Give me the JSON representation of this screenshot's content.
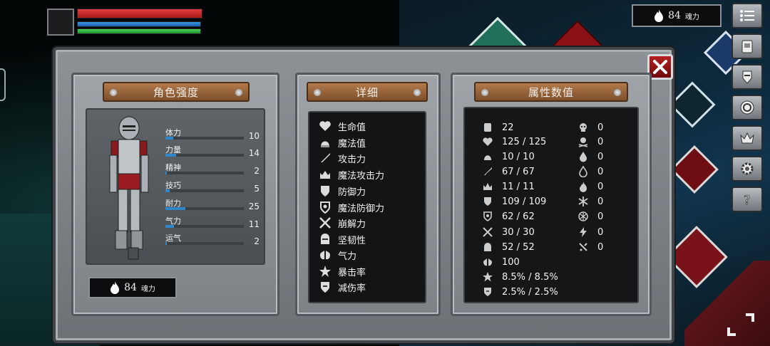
{
  "hud": {
    "soul_count": "84",
    "soul_unit": "魂力",
    "bars": {
      "health": 1.0,
      "mana": 1.0,
      "stamina": 1.0
    }
  },
  "panels": {
    "character": {
      "title": "角色强度",
      "stats": [
        {
          "label": "体力",
          "value": "10",
          "level": 0.1
        },
        {
          "label": "力量",
          "value": "14",
          "level": 0.14
        },
        {
          "label": "精神",
          "value": "2",
          "level": 0.02
        },
        {
          "label": "技巧",
          "value": "5",
          "level": 0.05
        },
        {
          "label": "耐力",
          "value": "25",
          "level": 0.25
        },
        {
          "label": "气力",
          "value": "11",
          "level": 0.11
        },
        {
          "label": "运气",
          "value": "2",
          "level": 0.02
        }
      ],
      "soul_count": "84",
      "soul_unit": "魂力"
    },
    "details": {
      "title": "详细",
      "items": [
        {
          "label": "生命值",
          "icon": "heart-icon"
        },
        {
          "label": "魔法值",
          "icon": "mana-icon"
        },
        {
          "label": "攻击力",
          "icon": "sword-icon"
        },
        {
          "label": "魔法攻击力",
          "icon": "magic-attack-icon"
        },
        {
          "label": "防御力",
          "icon": "shield-icon"
        },
        {
          "label": "魔法防御力",
          "icon": "magic-defense-icon"
        },
        {
          "label": "崩解力",
          "icon": "crossed-swords-icon"
        },
        {
          "label": "坚韧性",
          "icon": "helmet-icon"
        },
        {
          "label": "气力",
          "icon": "lungs-icon"
        },
        {
          "label": "暴击率",
          "icon": "critical-star-icon"
        },
        {
          "label": "减伤率",
          "icon": "damage-reduction-icon"
        }
      ]
    },
    "attributes": {
      "title": "属性数值",
      "left_values": [
        {
          "icon": "weight-icon",
          "value": "22"
        },
        {
          "icon": "heart-icon",
          "value": "125 / 125"
        },
        {
          "icon": "mana-icon",
          "value": "10 / 10"
        },
        {
          "icon": "sword-icon",
          "value": "67 / 67"
        },
        {
          "icon": "magic-attack-icon",
          "value": "11 / 11"
        },
        {
          "icon": "shield-icon",
          "value": "109 / 109"
        },
        {
          "icon": "magic-defense-icon",
          "value": "62 / 62"
        },
        {
          "icon": "crossed-swords-icon",
          "value": "30 / 30"
        },
        {
          "icon": "helmet-icon",
          "value": "52 / 52"
        },
        {
          "icon": "lungs-icon",
          "value": "100"
        },
        {
          "icon": "critical-star-icon",
          "value": "8.5% / 8.5%"
        },
        {
          "icon": "damage-reduction-icon",
          "value": "2.5% / 2.5%"
        }
      ],
      "right_values": [
        {
          "icon": "skull-icon",
          "value": "0"
        },
        {
          "icon": "poison-skull-icon",
          "value": "0"
        },
        {
          "icon": "blood-drop-icon",
          "value": "0"
        },
        {
          "icon": "fire-drop-icon",
          "value": "0"
        },
        {
          "icon": "fire-icon",
          "value": "0"
        },
        {
          "icon": "frost-icon",
          "value": "0"
        },
        {
          "icon": "frost-shield-icon",
          "value": "0"
        },
        {
          "icon": "lightning-icon",
          "value": "0"
        },
        {
          "icon": "bleed-icon",
          "value": "0"
        }
      ]
    }
  },
  "side_menu": [
    "menu-list-icon",
    "inventory-bag-icon",
    "armor-icon",
    "skills-emblem-icon",
    "crown-icon",
    "settings-gear-icon",
    "help-question-icon"
  ]
}
